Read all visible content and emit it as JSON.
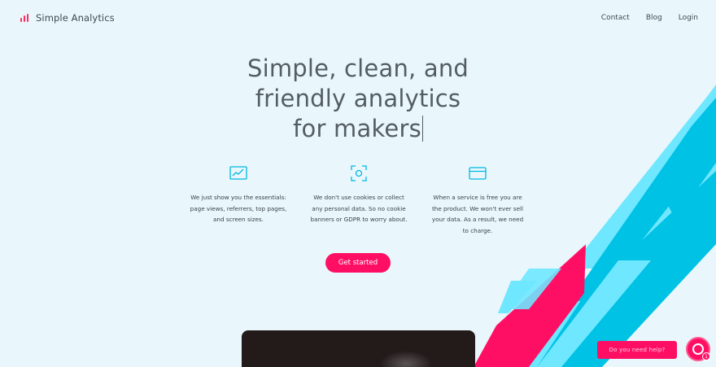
{
  "brand": {
    "name": "Simple Analytics",
    "accent": "#ff0f64",
    "icon": "bar-chart-icon"
  },
  "nav": {
    "items": [
      "Contact",
      "Blog",
      "Login"
    ]
  },
  "hero": {
    "lines": [
      "Simple, clean, and",
      "friendly analytics",
      "for makers"
    ]
  },
  "features": [
    {
      "icon": "line-chart-icon",
      "lines": [
        "We just show you the essentials:",
        "page views, referrers, top pages,",
        "and screen sizes."
      ]
    },
    {
      "icon": "privacy-camera-icon",
      "lines": [
        "We don't use cookies or collect",
        "any personal data. So no cookie",
        "banners or GDPR to worry about."
      ]
    },
    {
      "icon": "credit-card-icon",
      "lines": [
        "When a service is free you are",
        "the product. We won't ever sell",
        "your data. As a result, we need",
        "to charge."
      ]
    }
  ],
  "cta": {
    "label": "Get started"
  },
  "chat": {
    "prompt": "Do you need help?",
    "badge": "1"
  },
  "colors": {
    "background": "#e9f7fd",
    "cyan": "#00c2e5",
    "light_cyan": "#6fe7ff",
    "pink": "#ff0f64"
  }
}
